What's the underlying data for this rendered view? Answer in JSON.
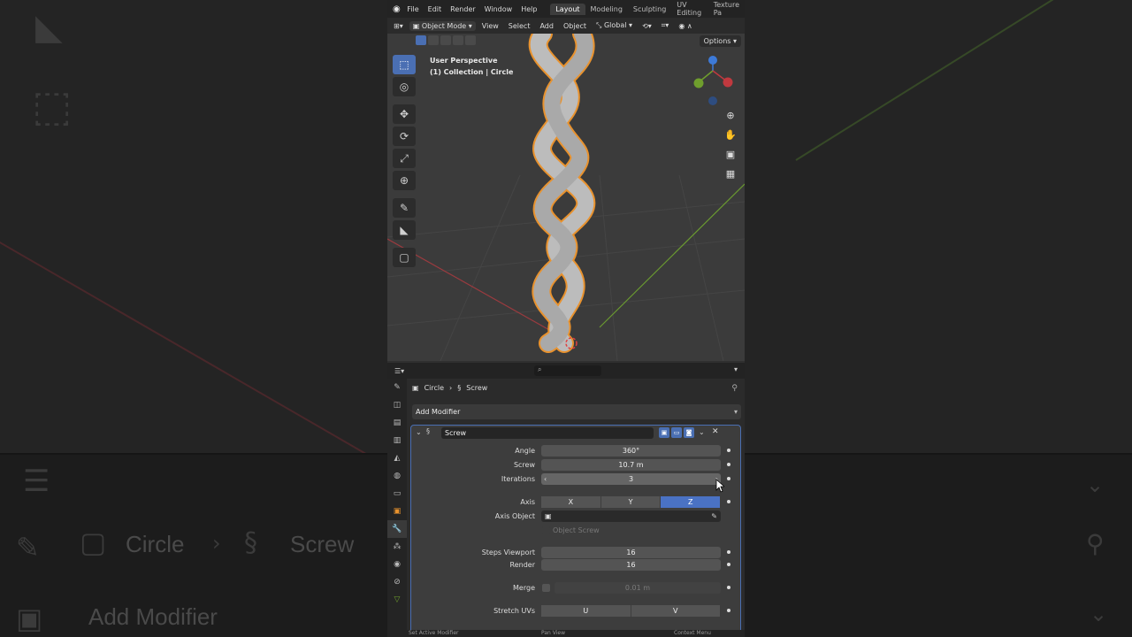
{
  "background": {
    "breadcrumb_object": "Circle",
    "breadcrumb_modifier": "Screw",
    "add_modifier_label": "Add Modifier"
  },
  "menubar": {
    "items": [
      "File",
      "Edit",
      "Render",
      "Window",
      "Help"
    ],
    "workspaces": [
      "Layout",
      "Modeling",
      "Sculpting",
      "UV Editing",
      "Texture Pa"
    ],
    "active_workspace": "Layout"
  },
  "header": {
    "mode": "Object Mode",
    "menus": [
      "View",
      "Select",
      "Add",
      "Object"
    ],
    "orientation": "Global"
  },
  "viewport": {
    "options_label": "Options",
    "perspective": "User Perspective",
    "collection": "(1) Collection | Circle"
  },
  "properties": {
    "breadcrumb_object": "Circle",
    "breadcrumb_modifier": "Screw",
    "add_modifier_label": "Add Modifier",
    "modifier": {
      "name": "Screw",
      "angle_label": "Angle",
      "angle": "360°",
      "screw_label": "Screw",
      "screw": "10.7 m",
      "iterations_label": "Iterations",
      "iterations": "3",
      "axis_label": "Axis",
      "axis_options": [
        "X",
        "Y",
        "Z"
      ],
      "axis_selected": "Z",
      "axis_object_label": "Axis Object",
      "object_screw_label": "Object Screw",
      "steps_viewport_label": "Steps Viewport",
      "steps_viewport": "16",
      "render_label": "Render",
      "render": "16",
      "merge_label": "Merge",
      "merge_value": "0.01 m",
      "stretch_uvs_label": "Stretch UVs",
      "stretch_u": "U",
      "stretch_v": "V"
    }
  },
  "statusbar": {
    "left": "Set Active Modifier",
    "middle": "Pan View",
    "right": "Context Menu"
  },
  "colors": {
    "accent": "#4a72c4",
    "selection_outline": "#e8922e",
    "x_axis": "#c0393f",
    "y_axis": "#6f9e2d",
    "z_axis": "#3d7ad8"
  }
}
